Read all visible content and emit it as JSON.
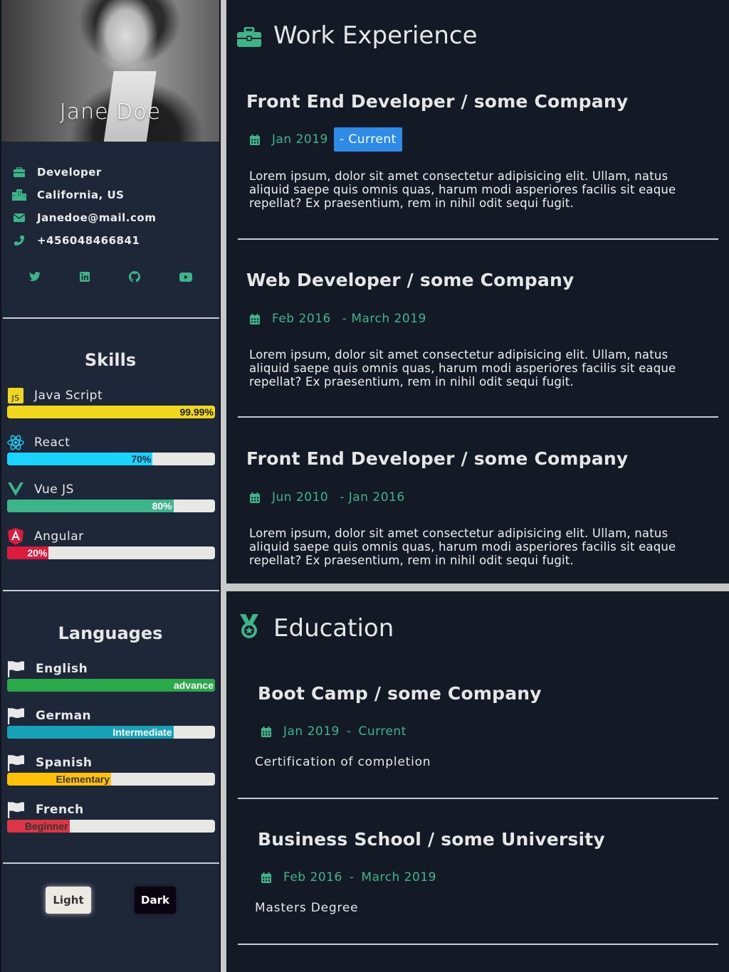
{
  "profile": {
    "name": "Jane Doe"
  },
  "contact": [
    {
      "icon": "briefcase-icon",
      "label": "Developer"
    },
    {
      "icon": "city-icon",
      "label": "California, US"
    },
    {
      "icon": "envelope-icon",
      "label": "Janedoe@mail.com"
    },
    {
      "icon": "phone-icon",
      "label": "+456048466841"
    }
  ],
  "social": [
    "twitter-icon",
    "linkedin-icon",
    "github-icon",
    "youtube-icon"
  ],
  "skills": {
    "title": "Skills",
    "items": [
      {
        "icon": "javascript-icon",
        "label": "Java Script",
        "value_label": "99.99%",
        "percent": 99.99,
        "color": "#f0d71e"
      },
      {
        "icon": "react-icon",
        "label": "React",
        "value_label": "70%",
        "percent": 70,
        "color": "#18d4ff"
      },
      {
        "icon": "vue-icon",
        "label": "Vue JS",
        "value_label": "80%",
        "percent": 80,
        "color": "#3eb489"
      },
      {
        "icon": "angular-icon",
        "label": "Angular",
        "value_label": "20%",
        "percent": 20,
        "color": "#dd1b3e"
      }
    ]
  },
  "languages": {
    "title": "Languages",
    "items": [
      {
        "icon": "flag-icon",
        "label": "English",
        "level": "advance",
        "percent": 100,
        "color": "#2aa84a"
      },
      {
        "icon": "flag-icon",
        "label": "German",
        "level": "Intermediate",
        "percent": 80,
        "color": "#17a2b8"
      },
      {
        "icon": "flag-icon",
        "label": "Spanish",
        "level": "Elementary",
        "percent": 50,
        "color": "#ffc107"
      },
      {
        "icon": "flag-icon",
        "label": "French",
        "level": "Beginner",
        "percent": 30,
        "color": "#dc3545"
      }
    ]
  },
  "theme": {
    "light": "Light",
    "dark": "Dark"
  },
  "work": {
    "title": "Work Experience",
    "jobs": [
      {
        "title": "Front End Developer / some Company",
        "start": "Jan 2019",
        "end": "- Current",
        "desc": "Lorem ipsum, dolor sit amet consectetur adipisicing elit. Ullam, natus aliquid saepe quis omnis quas, harum modi asperiores facilis sit eaque repellat? Ex praesentium, rem in nihil odit sequi fugit."
      },
      {
        "title": "Web Developer / some Company",
        "start": "Feb 2016",
        "end": "- March 2019",
        "desc": "Lorem ipsum, dolor sit amet consectetur adipisicing elit. Ullam, natus aliquid saepe quis omnis quas, harum modi asperiores facilis sit eaque repellat? Ex praesentium, rem in nihil odit sequi fugit."
      },
      {
        "title": "Front End Developer / some Company",
        "start": "Jun 2010",
        "end": "- Jan 2016",
        "desc": "Lorem ipsum, dolor sit amet consectetur adipisicing elit. Ullam, natus aliquid saepe quis omnis quas, harum modi asperiores facilis sit eaque repellat? Ex praesentium, rem in nihil odit sequi fugit."
      }
    ]
  },
  "education": {
    "title": "Education",
    "items": [
      {
        "title": "Boot Camp / some Company",
        "start": "Jan 2019",
        "sep": "-",
        "end": "Current",
        "desc": "Certification of completion"
      },
      {
        "title": "Business School / some University",
        "start": "Feb 2016",
        "sep": "-",
        "end": "March 2019",
        "desc": "Masters Degree"
      }
    ]
  },
  "colors": {
    "accent": "#3eb489",
    "badge": "#2f8be8",
    "panel": "#131a26",
    "sidebar": "#1e2738"
  }
}
